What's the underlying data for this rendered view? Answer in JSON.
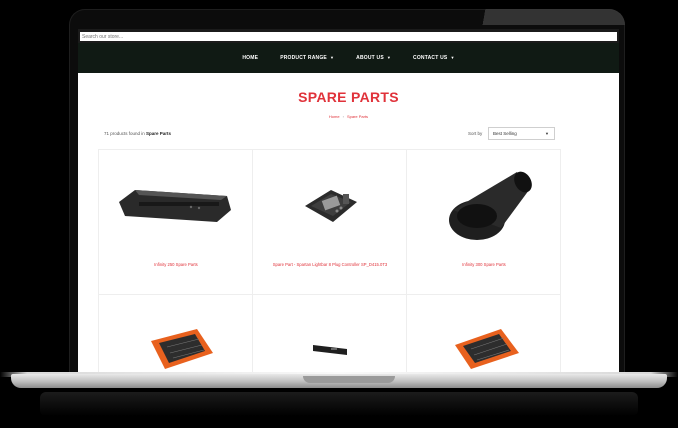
{
  "site": {
    "search": {
      "placeholder": "Search our store..."
    },
    "nav": [
      {
        "label": "HOME",
        "dropdown": false
      },
      {
        "label": "PRODUCT RANGE",
        "dropdown": true
      },
      {
        "label": "ABOUT US",
        "dropdown": true
      },
      {
        "label": "CONTACT US",
        "dropdown": true
      }
    ],
    "page_title": "SPARE PARTS",
    "breadcrumb": [
      "Home",
      "Spare Parts"
    ],
    "results": {
      "count_text": "71 products found in",
      "collection": "Spare Parts"
    },
    "sort": {
      "label": "Sort by",
      "value": "Best Selling"
    },
    "products": [
      {
        "name": "Infinity 250 Spare Parts",
        "sub": ""
      },
      {
        "name": "Spare Part - Spartan Lightbar 8 Plug Controller SP_D415.0T3",
        "sub": ""
      },
      {
        "name": "Infinity 300 Spare Parts",
        "sub": ""
      },
      {
        "name": "",
        "sub": ""
      },
      {
        "name": "",
        "sub": ""
      },
      {
        "name": "",
        "sub": ""
      }
    ]
  },
  "colors": {
    "accent": "#e0323a",
    "nav_bg": "#101a14",
    "laptop_frame": "#0c0c0c"
  },
  "icons": {
    "dropdown": "chevron-down-icon"
  }
}
